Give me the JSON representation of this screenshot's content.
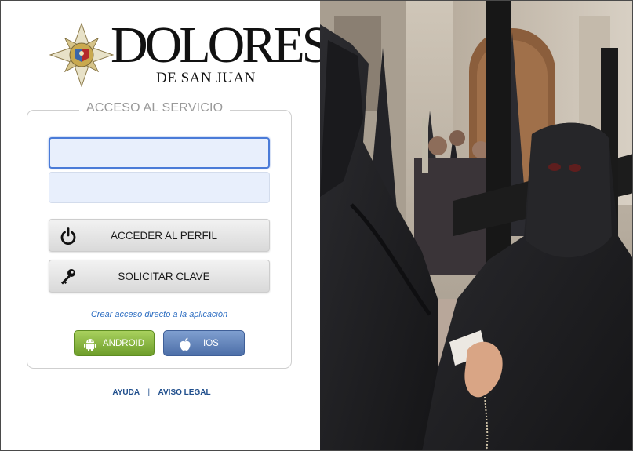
{
  "brand": {
    "name_big": "DOLORES",
    "name_small": "DE SAN JUAN"
  },
  "login": {
    "legend": "ACCESO AL SERVICIO",
    "user_value": "",
    "password_value": "",
    "access_button": "ACCEDER AL PERFIL",
    "key_button": "SOLICITAR CLAVE",
    "shortcut_text": "Crear acceso directo a la aplicación",
    "android_label": "ANDROID",
    "ios_label": "IOS"
  },
  "footer": {
    "help": "AYUDA",
    "separator": "|",
    "legal": "AVISO LEGAL"
  },
  "photo": {
    "subject": "hooded-penitents-procession",
    "colors": {
      "robe": "#1f1f22",
      "stone": "#c9bfb1",
      "cross": "#161616"
    }
  },
  "colors": {
    "accent_blue": "#2f6fc2",
    "android_green": "#7fae35",
    "ios_blue": "#5878b2",
    "input_fill": "#e8effc"
  }
}
